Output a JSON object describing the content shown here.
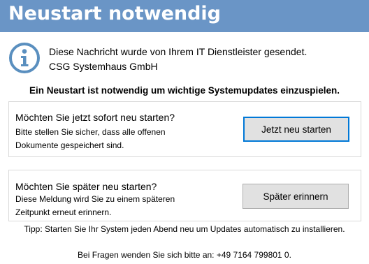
{
  "window": {
    "title": "Neustart notwendig",
    "title_bar_color": "#6a95c6"
  },
  "info": {
    "icon": "info-icon",
    "icon_color": "#5a8fbf",
    "line1": "Diese Nachricht wurde von Ihrem IT Dienstleister gesendet.",
    "line2": "CSG Systemhaus GmbH"
  },
  "headline": "Ein Neustart ist notwendig um wichtige Systemupdates einzuspielen.",
  "restart_now": {
    "question": "Möchten Sie jetzt sofort neu starten?",
    "desc_line1": "Bitte stellen Sie sicher, dass alle offenen",
    "desc_line2": "Dokumente gespeichert sind.",
    "button_label": "Jetzt neu starten"
  },
  "restart_later": {
    "question": "Möchten Sie später neu starten?",
    "desc_line1": "Diese Meldung wird Sie zu einem späteren",
    "desc_line2": "Zeitpunkt erneut erinnern.",
    "button_label": "Später erinnern"
  },
  "tip": "Tipp: Starten Sie Ihr System jeden Abend neu um Updates automatisch zu installieren.",
  "contact": "Bei Fragen wenden Sie sich bitte an: +49 7164 799801 0."
}
